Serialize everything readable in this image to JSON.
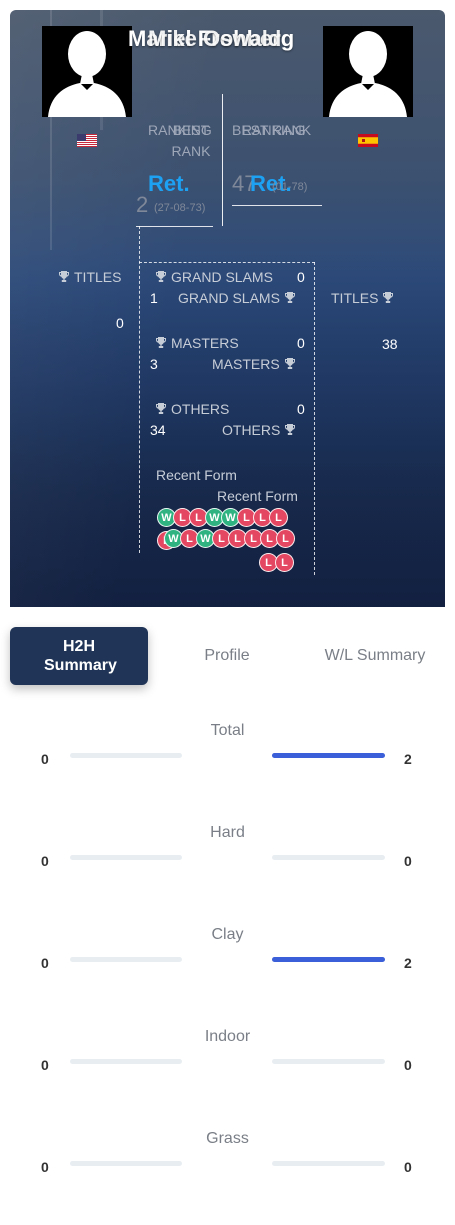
{
  "players": {
    "left": {
      "name": "Mariel Frohberg",
      "flag": "us-flag",
      "rank_label": "RANKING",
      "rank_value": "Ret.",
      "best_label": "BEST RANK",
      "best_value": "2",
      "best_date": "(27-08-73)"
    },
    "right": {
      "name": "Mike Oswald",
      "flag": "es-flag",
      "rank_label": "RANKING",
      "rank_value": "Ret.",
      "best_label": "BEST RANK",
      "best_value": "47",
      "best_date": "(01-78)"
    }
  },
  "titles": {
    "label": "TITLES",
    "left": {
      "titles": "0",
      "grand_slams": "1",
      "masters": "3",
      "others": "34"
    },
    "right": {
      "titles": "38",
      "grand_slams": "0",
      "masters": "0",
      "others": "0"
    },
    "grand_slams_label": "GRAND SLAMS",
    "masters_label": "MASTERS",
    "others_label": "OTHERS"
  },
  "recent_form": {
    "label": "Recent Form",
    "left": [
      "W",
      "L",
      "L",
      "W",
      "W",
      "L",
      "L",
      "L"
    ],
    "right": [
      "L",
      "W",
      "L",
      "W",
      "L",
      "L",
      "L",
      "L",
      "L",
      "L",
      "L"
    ]
  },
  "tabs": [
    {
      "label": "H2H Summary",
      "active": true
    },
    {
      "label": "Profile",
      "active": false
    },
    {
      "label": "W/L Summary",
      "active": false
    }
  ],
  "surfaces": [
    {
      "name": "Total",
      "left": "0",
      "right": "2",
      "left_fraction": 0,
      "right_fraction": 1
    },
    {
      "name": "Hard",
      "left": "0",
      "right": "0",
      "left_fraction": 0,
      "right_fraction": 0
    },
    {
      "name": "Clay",
      "left": "0",
      "right": "2",
      "left_fraction": 0,
      "right_fraction": 1
    },
    {
      "name": "Indoor",
      "left": "0",
      "right": "0",
      "left_fraction": 0,
      "right_fraction": 0
    },
    {
      "name": "Grass",
      "left": "0",
      "right": "0",
      "left_fraction": 0,
      "right_fraction": 0
    }
  ],
  "colors": {
    "win": "#2fb381",
    "loss": "#e44761",
    "bar": "#3b5fd8",
    "rank_value": "#1da1f2"
  }
}
